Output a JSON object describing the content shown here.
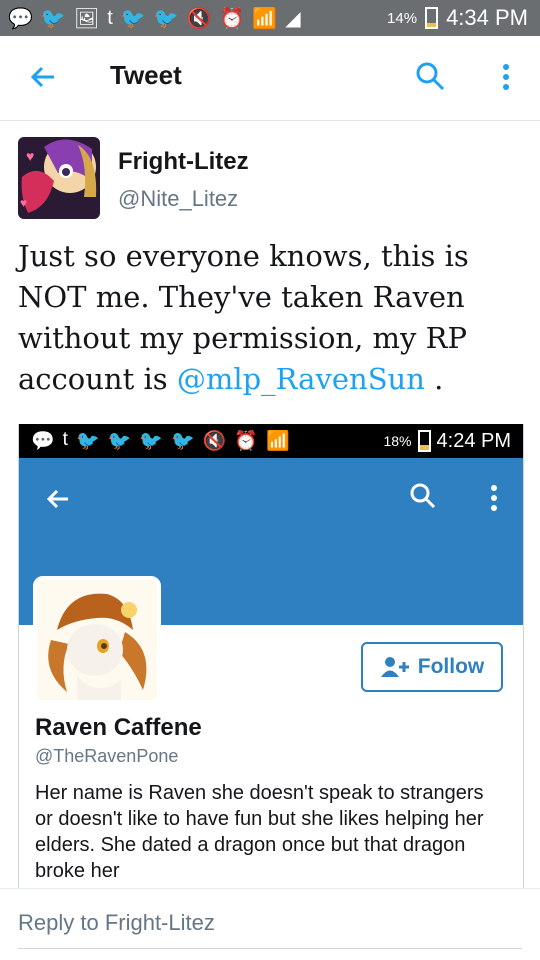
{
  "status_bar": {
    "battery": "14%",
    "time": "4:34 PM"
  },
  "app_bar": {
    "title": "Tweet"
  },
  "tweet": {
    "author_name": "Fright-Litez",
    "author_handle": "@Nite_Litez",
    "text_before_mention": "Just so everyone knows, this is NOT me. They've taken Raven without my permission, my RP account is ",
    "mention": "@mlp_RavenSun",
    "text_after_mention": " ."
  },
  "embedded_screenshot": {
    "status_bar": {
      "battery": "18%",
      "time": "4:24 PM"
    },
    "profile": {
      "follow_label": "Follow",
      "name": "Raven Caffene",
      "handle": "@TheRavenPone",
      "bio": "Her name is Raven she doesn't speak to strangers or doesn't like to have fun but she likes helping her elders. She dated a dragon once but that dragon broke her"
    }
  },
  "reply": {
    "placeholder": "Reply to Fright-Litez"
  },
  "colors": {
    "accent": "#1da1f2",
    "banner": "#2f80c1",
    "status_bar": "#6b6e71"
  }
}
